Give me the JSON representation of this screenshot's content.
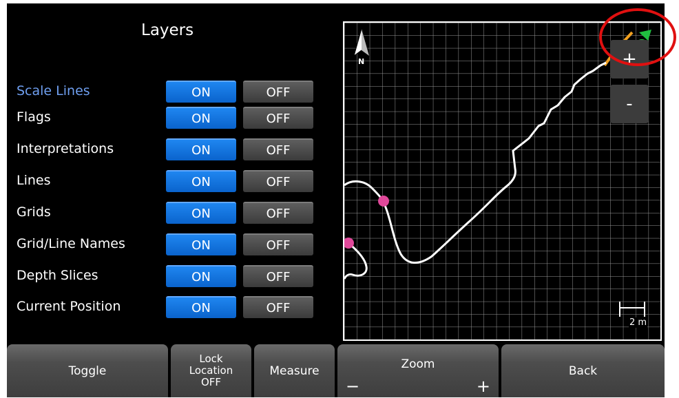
{
  "panel": {
    "title": "Layers"
  },
  "layers": [
    {
      "label": "Scale Lines",
      "on": "ON",
      "off": "OFF"
    },
    {
      "label": "Flags",
      "on": "ON",
      "off": "OFF"
    },
    {
      "label": "Interpretations",
      "on": "ON",
      "off": "OFF"
    },
    {
      "label": "Lines",
      "on": "ON",
      "off": "OFF"
    },
    {
      "label": "Grids",
      "on": "ON",
      "off": "OFF"
    },
    {
      "label": "Grid/Line Names",
      "on": "ON",
      "off": "OFF"
    },
    {
      "label": "Depth Slices",
      "on": "ON",
      "off": "OFF"
    },
    {
      "label": "Current Position",
      "on": "ON",
      "off": "OFF"
    }
  ],
  "map": {
    "north_label": "N",
    "zoom_in": "+",
    "zoom_out": "-",
    "scale_label": "2 m"
  },
  "bottom": {
    "toggle": "Toggle",
    "lock_line1": "Lock",
    "lock_line2": "Location",
    "lock_line3": "OFF",
    "measure": "Measure",
    "zoom": "Zoom",
    "zoom_minus": "−",
    "zoom_plus": "+",
    "back": "Back"
  },
  "colors": {
    "on_button": "#0a6fdc",
    "off_button": "#4a4a4a",
    "active_label": "#6f9ff0",
    "flag": "#e0489a",
    "position_marker": "#1040e0",
    "highlight_circle": "#e01010"
  }
}
